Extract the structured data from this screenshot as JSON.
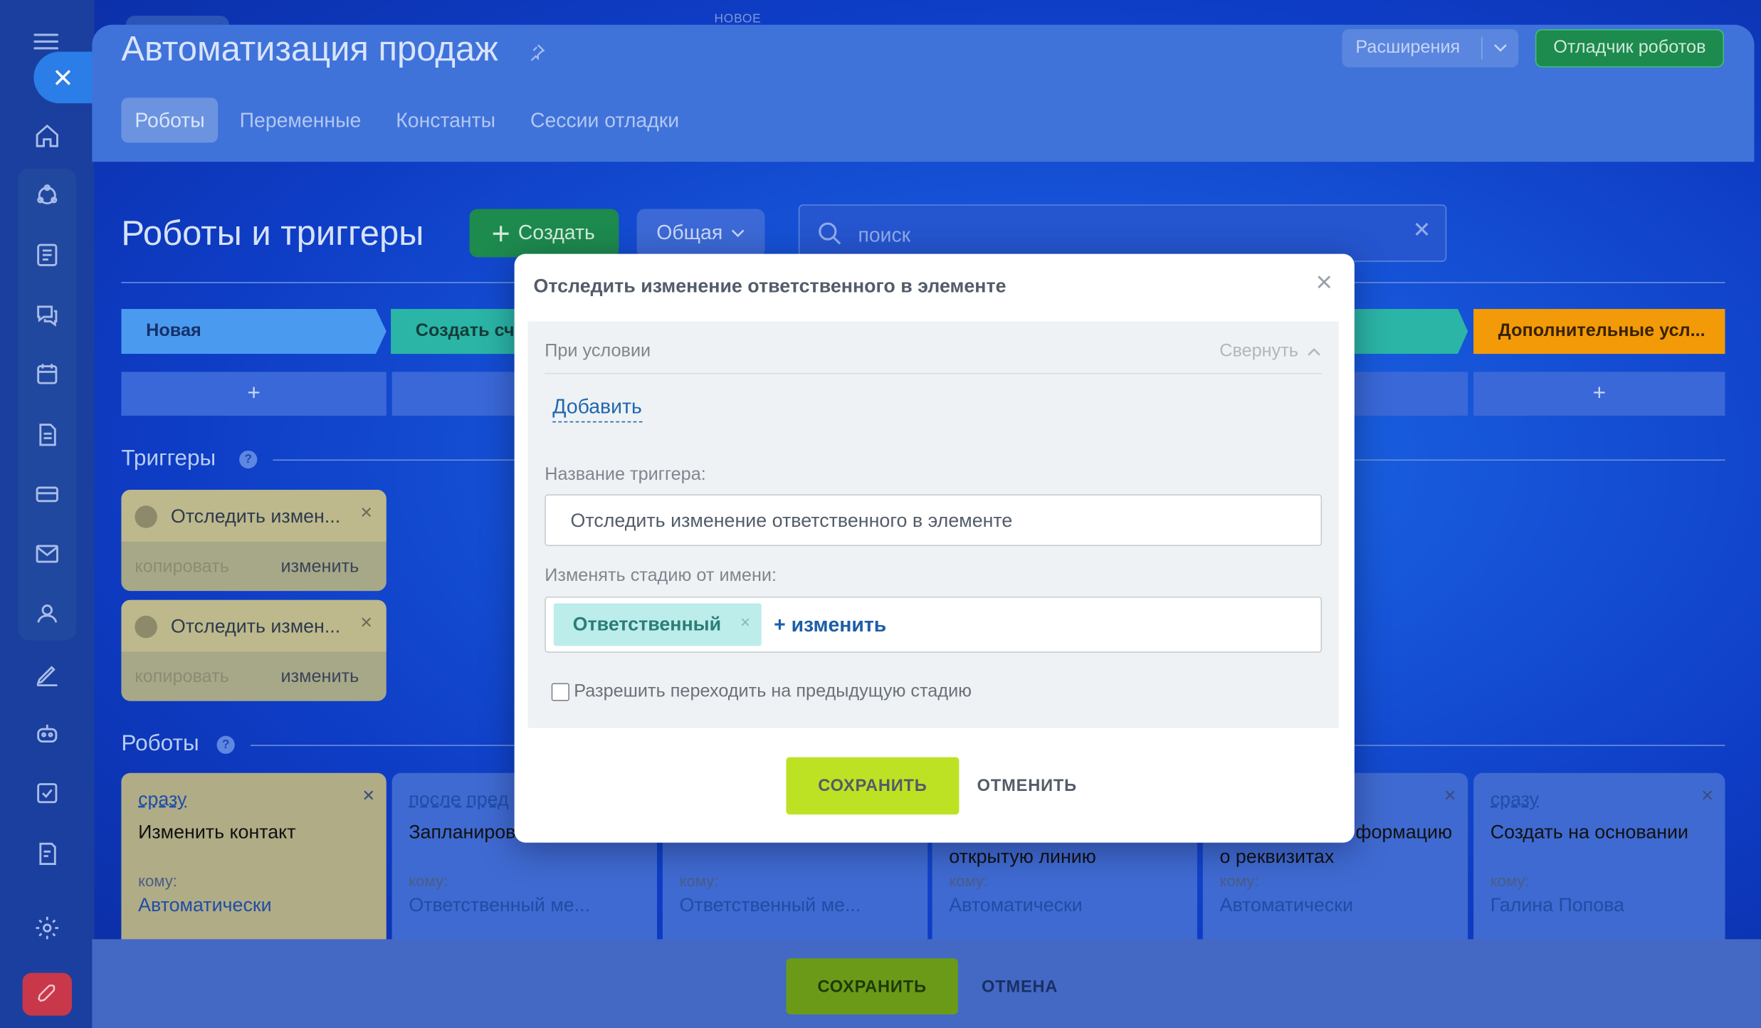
{
  "header": {
    "new_label": "НОВОЕ",
    "title": "Автоматизация продаж",
    "extensions_label": "Расширения",
    "debugger_label": "Отладчик роботов",
    "tabs": [
      {
        "label": "Роботы",
        "active": true
      },
      {
        "label": "Переменные",
        "active": false
      },
      {
        "label": "Константы",
        "active": false
      },
      {
        "label": "Сессии отладки",
        "active": false
      }
    ]
  },
  "sidebar": {
    "icons": [
      "home-icon",
      "crm-icon",
      "feed-icon",
      "chat-icon",
      "calendar-icon",
      "documents-icon",
      "card-icon",
      "mail-icon",
      "contacts-icon",
      "sign-icon",
      "robot-icon",
      "tasks-icon",
      "forms-icon",
      "settings-icon",
      "rocket-icon"
    ]
  },
  "main": {
    "title": "Роботы и триггеры",
    "create_label": "Создать",
    "general_label": "Общая",
    "search_placeholder": "поиск",
    "stages": [
      {
        "label": "Новая",
        "color": "#4a9bf0"
      },
      {
        "label": "Создать сч",
        "color": "#2bb5a6"
      },
      {
        "label": "Дополнительные усл...",
        "color": "#f29a08"
      }
    ],
    "stage_plus": "+",
    "triggers_title": "Триггеры",
    "triggers_help": "?",
    "triggers": [
      {
        "name": "Отследить измен...",
        "copy": "копировать",
        "edit": "изменить"
      },
      {
        "name": "Отследить измен...",
        "copy": "копировать",
        "edit": "изменить"
      }
    ],
    "robots_title": "Роботы",
    "robots_help": "?",
    "robots": [
      {
        "when": "сразу",
        "title": "Изменить контакт",
        "to_label": "кому:",
        "who": "Автоматически"
      },
      {
        "when": "после пред",
        "title": "Запланиров",
        "to_label": "кому:",
        "who": "Ответственный ме..."
      },
      {
        "when": "",
        "title": "",
        "to_label": "кому:",
        "who": "Ответственный ме..."
      },
      {
        "when": "",
        "title": "открытую линию",
        "to_label": "кому:",
        "who": "Автоматически"
      },
      {
        "when": "",
        "title": "формацию",
        "title2": "о реквизитах",
        "to_label": "кому:",
        "who": "Автоматически"
      },
      {
        "when": "сразу",
        "title": "Создать на основании",
        "to_label": "кому:",
        "who": "Галина Попова"
      }
    ]
  },
  "footer": {
    "save_label": "СОХРАНИТЬ",
    "cancel_label": "ОТМЕНА"
  },
  "modal": {
    "title": "Отследить изменение ответственного в элементе",
    "condition_label": "При условии",
    "collapse_label": "Свернуть",
    "add_link": "Добавить",
    "trigger_name_label": "Название триггера:",
    "trigger_name_value": "Отследить изменение ответственного в элементе",
    "stage_change_label": "Изменять стадию от имени:",
    "chip_label": "Ответственный",
    "chip_remove": "×",
    "change_link": "+ изменить",
    "allow_prev_label": "Разрешить переходить на предыдущую стадию",
    "allow_prev_checked": false,
    "save_label": "СОХРАНИТЬ",
    "cancel_label": "ОТМЕНИТЬ"
  },
  "colors": {
    "accent_green": "#bde223",
    "link_blue": "#2067b0",
    "debug_green": "#1d8a4e"
  }
}
